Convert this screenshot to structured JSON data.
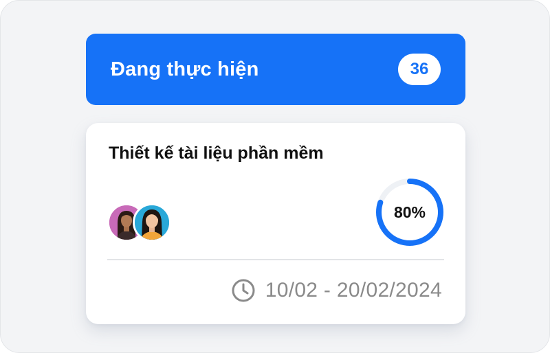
{
  "status": {
    "title": "Đang thực hiện",
    "count": "36",
    "color": "#1672f7"
  },
  "task": {
    "title": "Thiết kế tài liệu phần mềm",
    "progress": 0.8,
    "progress_label": "80%",
    "progress_color": "#1672f7",
    "date_icon": "clock-icon",
    "date_range": "10/02 - 20/02/2024",
    "assignees": [
      {
        "icon": "avatar-woman-pink-background"
      },
      {
        "icon": "avatar-woman-blue-background"
      }
    ]
  }
}
